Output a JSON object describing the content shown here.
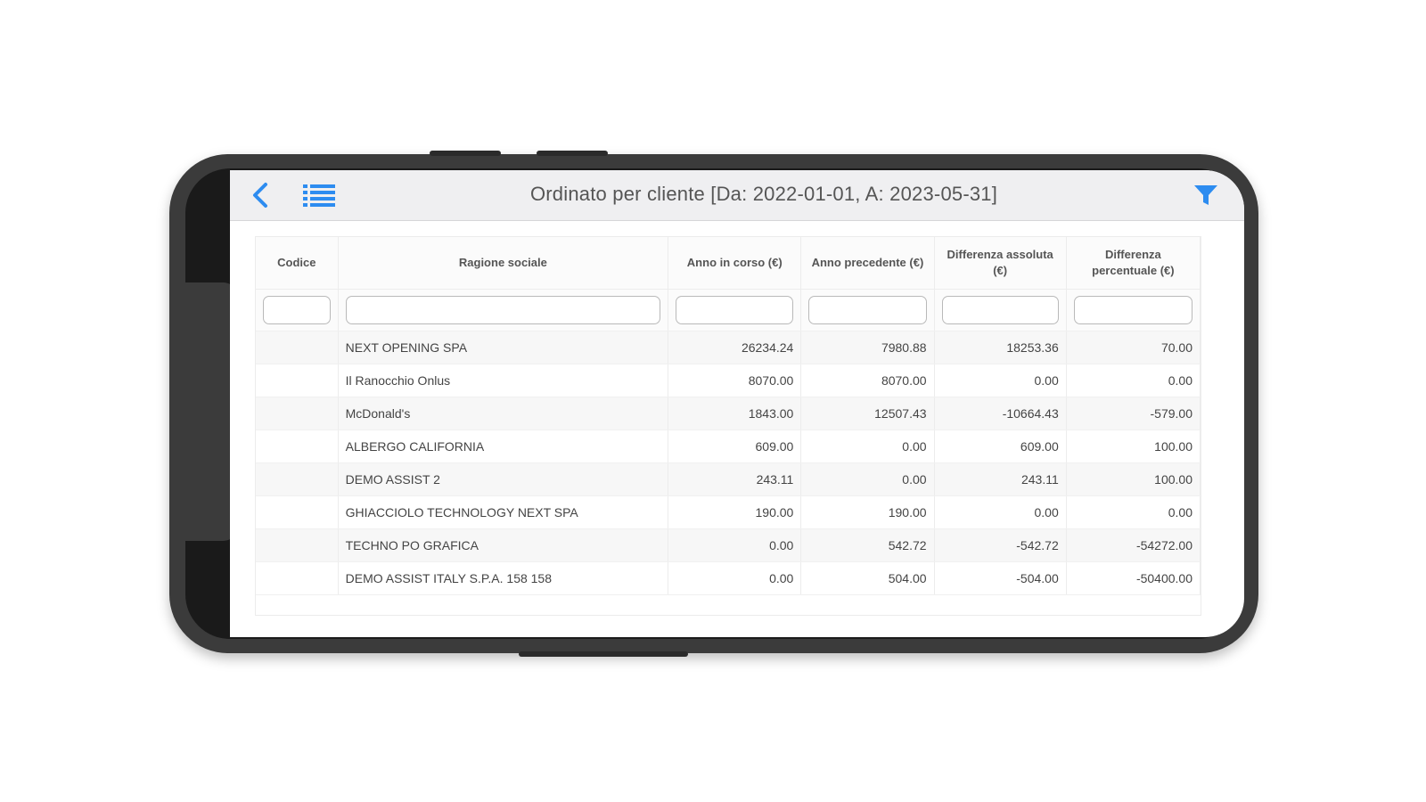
{
  "header": {
    "title": "Ordinato per cliente [Da: 2022-01-01, A: 2023-05-31]",
    "back_icon": "chevron-left-icon",
    "list_icon": "list-icon",
    "filter_icon": "filter-icon",
    "accent_color": "#2d8cf0"
  },
  "table": {
    "columns": [
      "Codice",
      "Ragione sociale",
      "Anno in corso (€)",
      "Anno precedente (€)",
      "Differenza assoluta (€)",
      "Differenza percentuale (€)"
    ],
    "filters": [
      "",
      "",
      "",
      "",
      "",
      ""
    ],
    "rows": [
      [
        "",
        "NEXT OPENING SPA",
        "26234.24",
        "7980.88",
        "18253.36",
        "70.00"
      ],
      [
        "",
        "Il Ranocchio Onlus",
        "8070.00",
        "8070.00",
        "0.00",
        "0.00"
      ],
      [
        "",
        "McDonald's",
        "1843.00",
        "12507.43",
        "-10664.43",
        "-579.00"
      ],
      [
        "",
        "ALBERGO CALIFORNIA",
        "609.00",
        "0.00",
        "609.00",
        "100.00"
      ],
      [
        "",
        "DEMO ASSIST 2",
        "243.11",
        "0.00",
        "243.11",
        "100.00"
      ],
      [
        "",
        "GHIACCIOLO TECHNOLOGY NEXT SPA",
        "190.00",
        "190.00",
        "0.00",
        "0.00"
      ],
      [
        "",
        "TECHNO PO GRAFICA",
        "0.00",
        "542.72",
        "-542.72",
        "-54272.00"
      ],
      [
        "",
        "DEMO ASSIST ITALY S.P.A. 158 158",
        "0.00",
        "504.00",
        "-504.00",
        "-50400.00"
      ]
    ]
  }
}
